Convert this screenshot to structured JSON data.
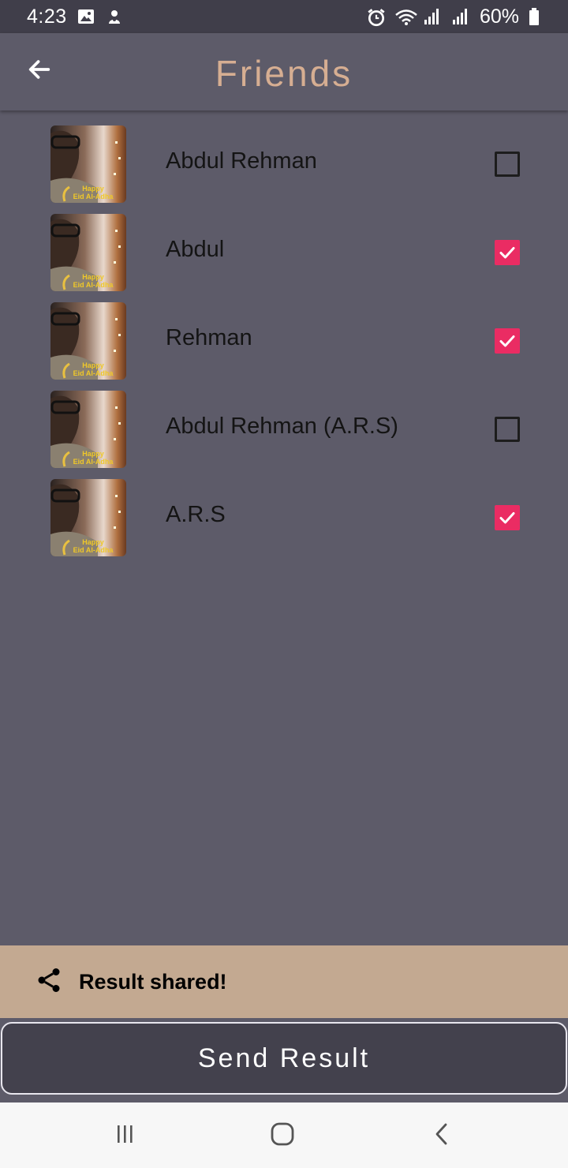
{
  "status_bar": {
    "time": "4:23",
    "battery": "60%",
    "icons": [
      "gallery-icon",
      "notification-icon",
      "alarm-icon",
      "wifi-icon",
      "signal-icon",
      "signal-icon",
      "battery-icon"
    ]
  },
  "app_bar": {
    "title": "Friends",
    "back_icon": "arrow-left-icon"
  },
  "friends": [
    {
      "name": "Abdul Rehman",
      "checked": false,
      "avatar_caption_1": "Happy",
      "avatar_caption_2": "Eid Al-Adha"
    },
    {
      "name": "Abdul",
      "checked": true,
      "avatar_caption_1": "Happy",
      "avatar_caption_2": "Eid Al-Adha"
    },
    {
      "name": "Rehman",
      "checked": true,
      "avatar_caption_1": "Happy",
      "avatar_caption_2": "Eid Al-Adha"
    },
    {
      "name": "Abdul Rehman (A.R.S)",
      "checked": false,
      "avatar_caption_1": "Happy",
      "avatar_caption_2": "Eid Al-Adha"
    },
    {
      "name": "A.R.S",
      "checked": true,
      "avatar_caption_1": "Happy",
      "avatar_caption_2": "Eid Al-Adha"
    }
  ],
  "snackbar": {
    "icon": "share-icon",
    "text": "Result shared!"
  },
  "send_button": {
    "label": "Send Result"
  },
  "nav_bar": {
    "icons": [
      "recents-icon",
      "home-icon",
      "back-icon"
    ]
  },
  "colors": {
    "background": "#5d5b69",
    "status_bar": "#403e4a",
    "title": "#d6ae92",
    "checkbox_checked": "#ea2c63",
    "snackbar": "#c3a991",
    "button": "#43414d"
  }
}
